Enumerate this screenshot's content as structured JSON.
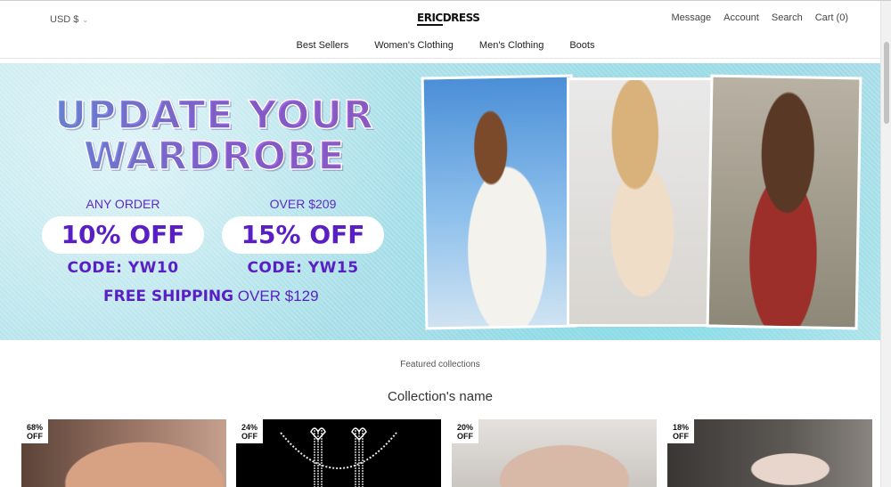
{
  "header": {
    "currency": "USD $",
    "logo_a": "ERIC",
    "logo_b": "DRESS",
    "links": [
      "Message",
      "Account",
      "Search",
      "Cart (0)"
    ]
  },
  "nav": [
    "Best Sellers",
    "Women's Clothing",
    "Men's Clothing",
    "Boots"
  ],
  "banner": {
    "headline_1": "UPDATE YOUR",
    "headline_2": "WARDROBE",
    "offers": [
      {
        "condition": "ANY ORDER",
        "discount": "10% OFF",
        "code": "CODE: YW10"
      },
      {
        "condition": "OVER $209",
        "discount": "15% OFF",
        "code": "CODE: YW15"
      }
    ],
    "free_shipping_bold": "FREE SHIPPING",
    "free_shipping_rest": " OVER $129"
  },
  "collections": {
    "kicker": "Featured collections",
    "title": "Collection's name",
    "cards": [
      {
        "badge_pct": "68%",
        "badge_off": "OFF"
      },
      {
        "badge_pct": "24%",
        "badge_off": "OFF"
      },
      {
        "badge_pct": "20%",
        "badge_off": "OFF"
      },
      {
        "badge_pct": "18%",
        "badge_off": "OFF"
      }
    ]
  },
  "colors": {
    "accent": "#5a1fc4",
    "banner_bg": "#a7dfe8"
  }
}
